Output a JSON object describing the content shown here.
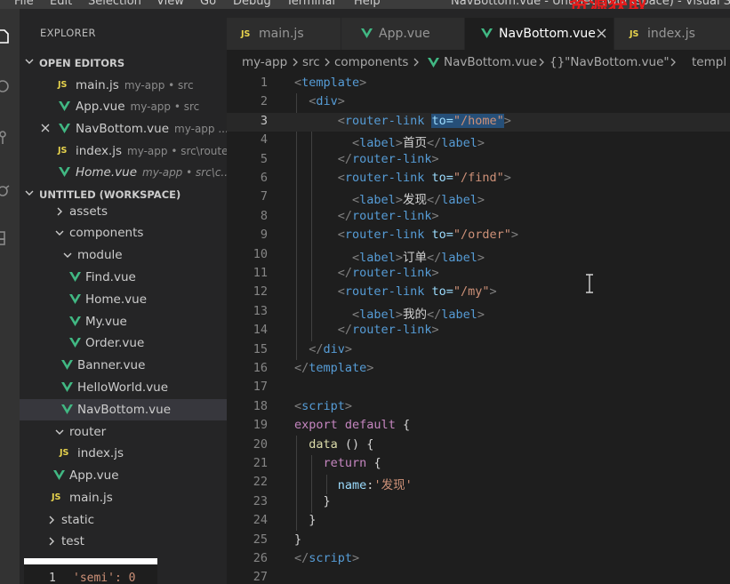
{
  "menubar": {
    "items": [
      "File",
      "Edit",
      "Selection",
      "View",
      "Go",
      "Debug",
      "Terminal",
      "Help"
    ],
    "window_title": "NavBottom.vue - Untitled (Workspace) - Visual Studio",
    "watermark": "资源获取"
  },
  "sidebar": {
    "title": "EXPLORER",
    "open_editors": {
      "header": "OPEN EDITORS",
      "items": [
        {
          "name": "main.js",
          "path": "my-app • src",
          "type": "js"
        },
        {
          "name": "App.vue",
          "path": "my-app • src",
          "type": "vue"
        },
        {
          "name": "NavBottom.vue",
          "path": "my-app ...",
          "type": "vue",
          "active": true
        },
        {
          "name": "index.js",
          "path": "my-app • src\\router",
          "type": "js"
        },
        {
          "name": "Home.vue",
          "path": "my-app • src\\c...",
          "type": "vue",
          "italic": true
        }
      ]
    },
    "workspace": {
      "header": "UNTITLED (WORKSPACE)",
      "tree": [
        {
          "name": "assets",
          "kind": "folder-closed"
        },
        {
          "name": "components",
          "kind": "folder-open"
        },
        {
          "name": "module",
          "kind": "folder-open"
        },
        {
          "name": "Find.vue",
          "kind": "vue"
        },
        {
          "name": "Home.vue",
          "kind": "vue"
        },
        {
          "name": "My.vue",
          "kind": "vue"
        },
        {
          "name": "Order.vue",
          "kind": "vue"
        },
        {
          "name": "Banner.vue",
          "kind": "vue"
        },
        {
          "name": "HelloWorld.vue",
          "kind": "vue"
        },
        {
          "name": "NavBottom.vue",
          "kind": "vue",
          "selected": true
        },
        {
          "name": "router",
          "kind": "folder-open"
        },
        {
          "name": "index.js",
          "kind": "js"
        },
        {
          "name": "App.vue",
          "kind": "vue"
        },
        {
          "name": "main.js",
          "kind": "js"
        },
        {
          "name": "static",
          "kind": "folder-closed"
        },
        {
          "name": "test",
          "kind": "folder-closed"
        }
      ]
    },
    "popup": {
      "line": "1",
      "code": "'semi': 0"
    }
  },
  "tabs": [
    {
      "label": "main.js",
      "type": "js"
    },
    {
      "label": "App.vue",
      "type": "vue"
    },
    {
      "label": "NavBottom.vue",
      "type": "vue",
      "active": true
    },
    {
      "label": "index.js",
      "type": "js"
    }
  ],
  "breadcrumb": [
    "my-app",
    "src",
    "components",
    "NavBottom.vue",
    "{}\"NavBottom.vue\"",
    "templ"
  ],
  "editor": {
    "current_line": 3,
    "line_numbers": [
      "1",
      "2",
      "3",
      "4",
      "5",
      "6",
      "7",
      "8",
      "9",
      "10",
      "11",
      "12",
      "13",
      "14",
      "15",
      "16",
      "17",
      "18",
      "19",
      "20",
      "21",
      "22",
      "23",
      "24",
      "25",
      "26",
      "27"
    ],
    "lines": [
      [
        [
          "br",
          "<"
        ],
        [
          "tag",
          "template"
        ],
        [
          "br",
          ">"
        ]
      ],
      [
        [
          "sp",
          "  "
        ],
        [
          "br",
          "<"
        ],
        [
          "tag",
          "div"
        ],
        [
          "br",
          ">"
        ]
      ],
      [
        [
          "sp",
          "      "
        ],
        [
          "br",
          "<"
        ],
        [
          "tag",
          "router-link"
        ],
        [
          "sp",
          " "
        ],
        [
          "attrsel",
          "to="
        ],
        [
          "strsel",
          "\"/home\""
        ],
        [
          "br",
          ">"
        ]
      ],
      [
        [
          "sp",
          "        "
        ],
        [
          "br",
          "<"
        ],
        [
          "tag",
          "label"
        ],
        [
          "br",
          ">"
        ],
        [
          "txt",
          "首页"
        ],
        [
          "br",
          "</"
        ],
        [
          "tag",
          "label"
        ],
        [
          "br",
          ">"
        ]
      ],
      [
        [
          "sp",
          "      "
        ],
        [
          "br",
          "</"
        ],
        [
          "tag",
          "router-link"
        ],
        [
          "br",
          ">"
        ]
      ],
      [
        [
          "sp",
          "      "
        ],
        [
          "br",
          "<"
        ],
        [
          "tag",
          "router-link"
        ],
        [
          "sp",
          " "
        ],
        [
          "attr",
          "to="
        ],
        [
          "str",
          "\"/find\""
        ],
        [
          "br",
          ">"
        ]
      ],
      [
        [
          "sp",
          "        "
        ],
        [
          "br",
          "<"
        ],
        [
          "tag",
          "label"
        ],
        [
          "br",
          ">"
        ],
        [
          "txt",
          "发现"
        ],
        [
          "br",
          "</"
        ],
        [
          "tag",
          "label"
        ],
        [
          "br",
          ">"
        ]
      ],
      [
        [
          "sp",
          "      "
        ],
        [
          "br",
          "</"
        ],
        [
          "tag",
          "router-link"
        ],
        [
          "br",
          ">"
        ]
      ],
      [
        [
          "sp",
          "      "
        ],
        [
          "br",
          "<"
        ],
        [
          "tag",
          "router-link"
        ],
        [
          "sp",
          " "
        ],
        [
          "attr",
          "to="
        ],
        [
          "str",
          "\"/order\""
        ],
        [
          "br",
          ">"
        ]
      ],
      [
        [
          "sp",
          "        "
        ],
        [
          "br",
          "<"
        ],
        [
          "tag",
          "label"
        ],
        [
          "br",
          ">"
        ],
        [
          "txt",
          "订单"
        ],
        [
          "br",
          "</"
        ],
        [
          "tag",
          "label"
        ],
        [
          "br",
          ">"
        ]
      ],
      [
        [
          "sp",
          "      "
        ],
        [
          "br",
          "</"
        ],
        [
          "tag",
          "router-link"
        ],
        [
          "br",
          ">"
        ]
      ],
      [
        [
          "sp",
          "      "
        ],
        [
          "br",
          "<"
        ],
        [
          "tag",
          "router-link"
        ],
        [
          "sp",
          " "
        ],
        [
          "attr",
          "to="
        ],
        [
          "str",
          "\"/my\""
        ],
        [
          "br",
          ">"
        ]
      ],
      [
        [
          "sp",
          "        "
        ],
        [
          "br",
          "<"
        ],
        [
          "tag",
          "label"
        ],
        [
          "br",
          ">"
        ],
        [
          "txt",
          "我的"
        ],
        [
          "br",
          "</"
        ],
        [
          "tag",
          "label"
        ],
        [
          "br",
          ">"
        ]
      ],
      [
        [
          "sp",
          "      "
        ],
        [
          "br",
          "</"
        ],
        [
          "tag",
          "router-link"
        ],
        [
          "br",
          ">"
        ]
      ],
      [
        [
          "sp",
          "  "
        ],
        [
          "br",
          "</"
        ],
        [
          "tag",
          "div"
        ],
        [
          "br",
          ">"
        ]
      ],
      [
        [
          "br",
          "</"
        ],
        [
          "tag",
          "template"
        ],
        [
          "br",
          ">"
        ]
      ],
      [],
      [
        [
          "br",
          "<"
        ],
        [
          "tag",
          "script"
        ],
        [
          "br",
          ">"
        ]
      ],
      [
        [
          "kw",
          "export"
        ],
        [
          "sp",
          " "
        ],
        [
          "kw",
          "default"
        ],
        [
          "sp",
          " "
        ],
        [
          "punc",
          "{"
        ]
      ],
      [
        [
          "sp",
          "  "
        ],
        [
          "fn",
          "data"
        ],
        [
          "sp",
          " "
        ],
        [
          "punc",
          "() {"
        ]
      ],
      [
        [
          "sp",
          "    "
        ],
        [
          "kw",
          "return"
        ],
        [
          "sp",
          " "
        ],
        [
          "punc",
          "{"
        ]
      ],
      [
        [
          "sp",
          "      "
        ],
        [
          "prop",
          "name"
        ],
        [
          "punc",
          ":"
        ],
        [
          "str",
          "'发现'"
        ]
      ],
      [
        [
          "sp",
          "    "
        ],
        [
          "punc",
          "}"
        ]
      ],
      [
        [
          "sp",
          "  "
        ],
        [
          "punc",
          "}"
        ]
      ],
      [
        [
          "punc",
          "}"
        ]
      ],
      [
        [
          "br",
          "</"
        ],
        [
          "tag",
          "script"
        ],
        [
          "br",
          ">"
        ]
      ],
      []
    ]
  },
  "colors": {
    "editor_bg": "#1e1e1e",
    "sidebar_bg": "#252526",
    "activity_bg": "#333333",
    "vue_green": "#41b883",
    "js_yellow": "#e8d44d",
    "watermark_red": "#e81b1b"
  }
}
